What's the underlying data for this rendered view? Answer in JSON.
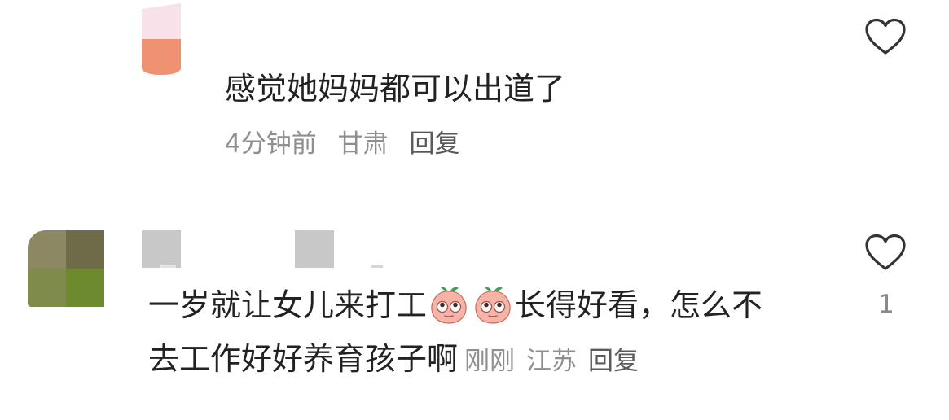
{
  "comments": [
    {
      "text": "感觉她妈妈都可以出道了",
      "time": "4分钟前",
      "location": "甘肃",
      "reply_label": "回复",
      "like_count": "",
      "avatar_colors": [
        "#f9e1e9",
        "#ef9272"
      ]
    },
    {
      "text_part1": "一岁就让女儿来打工",
      "emojis": [
        "peach-emoji",
        "peach-emoji"
      ],
      "text_part2": "长得好看，怎么不",
      "text_line2": "去工作好好养育孩子啊",
      "time": "刚刚",
      "location": "江苏",
      "reply_label": "回复",
      "like_count": "1",
      "avatar_colors": [
        "#8b8863",
        "#6f6a47",
        "#7e8b4a",
        "#6d8a2e"
      ]
    }
  ],
  "icons": {
    "like": "heart-outline-icon",
    "emoji": "peach-emoji"
  },
  "colors": {
    "text": "#222222",
    "meta": "#8f8f8f",
    "reply": "#5a5a5a",
    "heart_stroke": "#333333"
  }
}
